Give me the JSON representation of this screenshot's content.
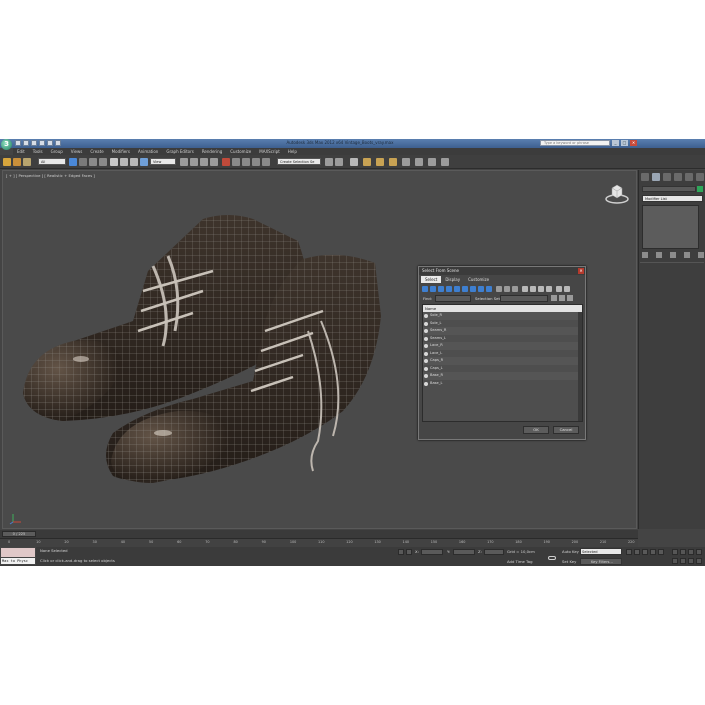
{
  "window": {
    "title": "Autodesk 3ds Max  2012 x64     Vintage_Boots_vray.max",
    "logo_letter": "3",
    "search_placeholder": "Type a keyword or phrase",
    "btn_minimize": "_",
    "btn_maximize": "□",
    "btn_close": "✕"
  },
  "menu": [
    "Edit",
    "Tools",
    "Group",
    "Views",
    "Create",
    "Modifiers",
    "Animation",
    "Graph Editors",
    "Rendering",
    "Customize",
    "MAXScript",
    "Help"
  ],
  "toolbar": {
    "selection_filter": "All",
    "ref_coord": "View",
    "named_selection": "Create Selection Se"
  },
  "viewport": {
    "label": "[ + ] [ Perspective ] [ Realistic + Edged Faces ]",
    "frame_counter": "0 / 225"
  },
  "command_panel": {
    "modifier_list": "Modifier List"
  },
  "dialog": {
    "title": "Select From Scene",
    "close": "✕",
    "menu": [
      "Select",
      "Display",
      "Customize"
    ],
    "active_menu": "Select",
    "find_label": "Find:",
    "selection_set_label": "Selection Set:",
    "column_header": "Name",
    "rows": [
      "Sole_R",
      "Sole_L",
      "Seams_R",
      "Seams_L",
      "Lace_R",
      "Lace_L",
      "Caps_R",
      "Caps_L",
      "Base_R",
      "Base_L"
    ],
    "ok_label": "OK",
    "cancel_label": "Cancel"
  },
  "timeline": {
    "ticks": [
      "0",
      "10",
      "20",
      "30",
      "40",
      "50",
      "60",
      "70",
      "80",
      "90",
      "100",
      "110",
      "120",
      "130",
      "140",
      "150",
      "160",
      "170",
      "180",
      "190",
      "200",
      "210",
      "220"
    ]
  },
  "status": {
    "maxscript_text": "Max to Physc",
    "line1": "None Selected",
    "line2": "Click or click-and-drag to select objects",
    "x_label": "X:",
    "y_label": "Y:",
    "z_label": "Z:",
    "grid": "Grid = 10,0cm",
    "add_time_tag": "Add Time Tag",
    "auto_key": "Auto Key",
    "set_key": "Set Key",
    "selected_option": "Selected",
    "key_filters": "Key Filters..."
  },
  "colors": {
    "accent_blue": "#3b6fb8",
    "viewport_bg": "#4a4a4a",
    "panel_bg": "#3e3e3e",
    "swatch_green": "#2ea85a"
  }
}
